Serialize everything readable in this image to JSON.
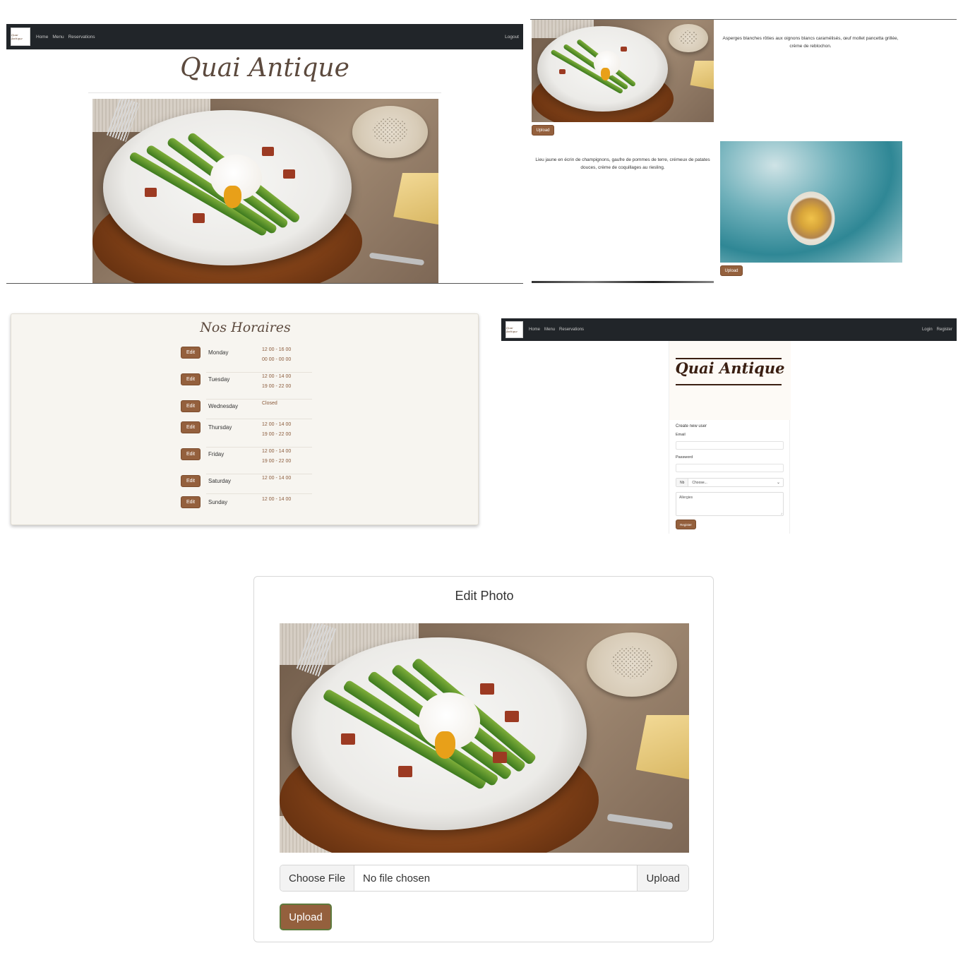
{
  "panel_home": {
    "nav": {
      "links": [
        "Home",
        "Menu",
        "Reservations"
      ],
      "right": "Logout"
    },
    "title": "Quai Antique"
  },
  "panel_menu": {
    "item1": {
      "description": "Asperges blanches rôties aux oignons blancs caramélisés, œuf mollet pancetta grillée, crème de reblochon.",
      "upload": "Upload"
    },
    "item2": {
      "description": "Lieu jaune en écrin de champignons, gaufre de pommes de terre, crémeux de patates douces, crème de coquillages au riesling.",
      "upload": "Upload"
    }
  },
  "panel_hours": {
    "title": "Nos Horaires",
    "edit_label": "Edit",
    "rows": [
      {
        "day": "Monday",
        "line1": "12 00 - 16 00",
        "line2": "00 00 - 00 00"
      },
      {
        "day": "Tuesday",
        "line1": "12 00 - 14 00",
        "line2": "19 00 - 22 00"
      },
      {
        "day": "Wednesday",
        "line1": "Closed",
        "line2": ""
      },
      {
        "day": "Thursday",
        "line1": "12 00 - 14 00",
        "line2": "19 00 - 22 00"
      },
      {
        "day": "Friday",
        "line1": "12 00 - 14 00",
        "line2": "19 00 - 22 00"
      },
      {
        "day": "Saturday",
        "line1": "12 00 - 14 00",
        "line2": ""
      },
      {
        "day": "Sunday",
        "line1": "12 00 - 14 00",
        "line2": ""
      }
    ]
  },
  "panel_register": {
    "nav": {
      "links": [
        "Home",
        "Menu",
        "Reservations"
      ],
      "right": [
        "Login",
        "Register"
      ]
    },
    "logo": "Quai Antique",
    "heading": "Create new user",
    "email_label": "Email",
    "password_label": "Password",
    "select_prefix": "Nb",
    "select_value": "Choose...",
    "allergies_placeholder": "Allergies",
    "register_button": "Register"
  },
  "panel_edit": {
    "title": "Edit Photo",
    "choose_file": "Choose File",
    "no_file": "No file chosen",
    "input_upload": "Upload",
    "upload_button": "Upload"
  },
  "colors": {
    "accent": "#94603d",
    "navbar": "#212529",
    "hours_bg": "#f7f5f0",
    "hours_time": "#8a5a3a"
  }
}
